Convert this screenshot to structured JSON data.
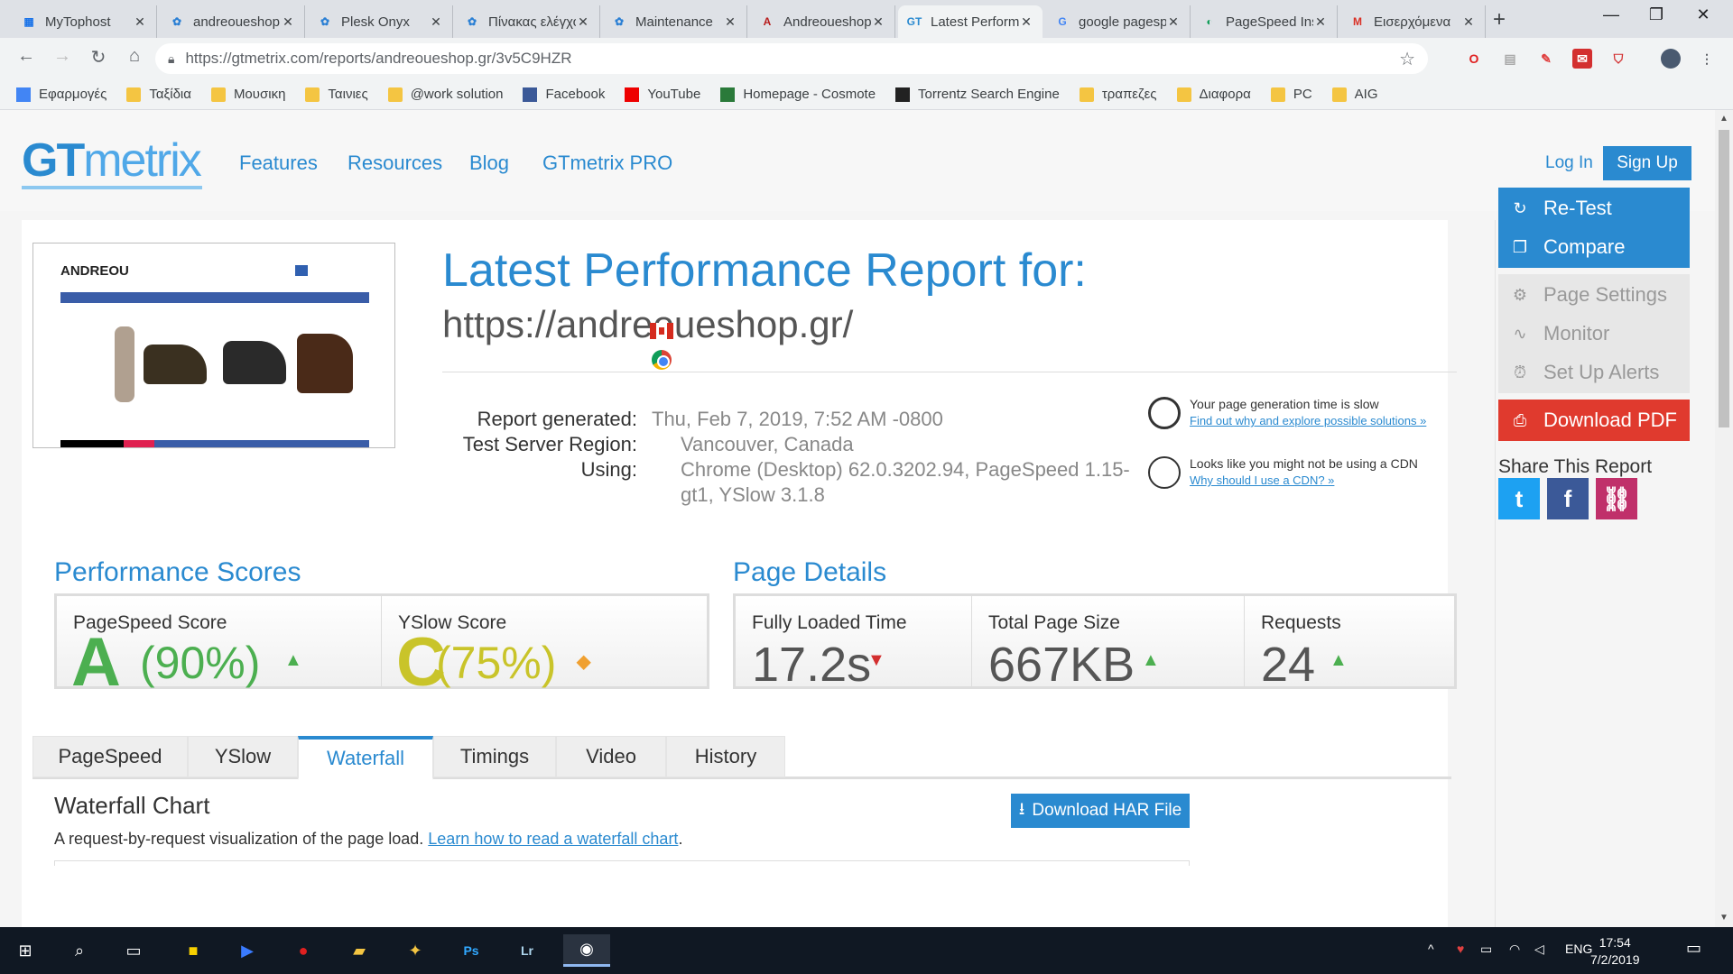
{
  "browser": {
    "tabs": [
      {
        "label": "MyTophost",
        "icon": "grid-icon",
        "color": "#1a73e8"
      },
      {
        "label": "andreoueshop",
        "icon": "plesk-icon",
        "color": "#2a7fd4"
      },
      {
        "label": "Plesk Onyx",
        "icon": "plesk-icon",
        "color": "#2a7fd4"
      },
      {
        "label": "Πίνακας ελέγχου",
        "icon": "plesk-icon",
        "color": "#2a7fd4"
      },
      {
        "label": "Maintenance",
        "icon": "plesk-icon",
        "color": "#2a7fd4"
      },
      {
        "label": "Andreoueshop",
        "icon": "a-logo-icon",
        "color": "#b71c1c"
      },
      {
        "label": "Latest Performance",
        "icon": "gtmetrix-icon",
        "color": "#2a8ad0"
      },
      {
        "label": "google pagespeed",
        "icon": "google-icon",
        "color": "#4285f4"
      },
      {
        "label": "PageSpeed Insights",
        "icon": "pagespeed-icon",
        "color": "#0f9d58"
      },
      {
        "label": "Εισερχόμενα",
        "icon": "gmail-icon",
        "color": "#d93025"
      }
    ],
    "tab_glyphs": [
      "▦",
      "✿",
      "✿",
      "✿",
      "✿",
      "A",
      "GT",
      "G",
      "◐",
      "M"
    ],
    "active_tab": 6,
    "new_tab": "+",
    "url": "https://gtmetrix.com/reports/andreoueshop.gr/3v5C9HZR",
    "bookmarks": [
      {
        "label": "Εφαρμογές",
        "icon": "apps-icon"
      },
      {
        "label": "Ταξίδια",
        "icon": "folder-icon"
      },
      {
        "label": "Μουσικη",
        "icon": "folder-icon"
      },
      {
        "label": "Ταινιες",
        "icon": "folder-icon"
      },
      {
        "label": "@work solution",
        "icon": "folder-icon"
      },
      {
        "label": "Facebook",
        "icon": "facebook-icon"
      },
      {
        "label": "YouTube",
        "icon": "youtube-icon"
      },
      {
        "label": "Homepage - Cosmote",
        "icon": "cosmote-icon"
      },
      {
        "label": "Torrentz Search Engine",
        "icon": "torrentz-icon"
      },
      {
        "label": "τραπεζες",
        "icon": "folder-icon"
      },
      {
        "label": "Διαφορα",
        "icon": "folder-icon"
      },
      {
        "label": "PC",
        "icon": "folder-icon"
      },
      {
        "label": "AIG",
        "icon": "folder-icon"
      }
    ]
  },
  "site": {
    "logo_gt": "GT",
    "logo_metrix": "metrix",
    "nav": [
      "Features",
      "Resources",
      "Blog",
      "GTmetrix PRO"
    ],
    "login": "Log In",
    "signup": "Sign Up"
  },
  "report": {
    "title": "Latest Performance Report for:",
    "url": "https://andreoueshop.gr/",
    "thumb_brand": "ANDREOU",
    "generated_label": "Report generated:",
    "generated_value": "Thu, Feb 7, 2019, 7:52 AM -0800",
    "region_label": "Test Server Region:",
    "region_value": "Vancouver, Canada",
    "using_label": "Using:",
    "using_value_1": "Chrome (Desktop) 62.0.3202.94, PageSpeed 1.15-",
    "using_value_2": "gt1, YSlow 3.1.8",
    "tip1_text": "Your page generation time is slow",
    "tip1_link": "Find out why and explore possible solutions »",
    "tip2_text": "Looks like you might not be using a CDN",
    "tip2_link": "Why should I use a CDN? »"
  },
  "scores": {
    "title": "Performance Scores",
    "pagespeed_label": "PageSpeed Score",
    "pagespeed_grade": "A",
    "pagespeed_pct": "(90%)",
    "pagespeed_color": "#4caf50",
    "yslow_label": "YSlow Score",
    "yslow_grade": "C",
    "yslow_pct": "(75%)",
    "yslow_color": "#c9c42a"
  },
  "details": {
    "title": "Page Details",
    "load_label": "Fully Loaded Time",
    "load_value": "17.2s",
    "size_label": "Total Page Size",
    "size_value": "667KB",
    "req_label": "Requests",
    "req_value": "24"
  },
  "tabs": [
    "PageSpeed",
    "YSlow",
    "Waterfall",
    "Timings",
    "Video",
    "History"
  ],
  "active_tab": "Waterfall",
  "waterfall": {
    "title": "Waterfall Chart",
    "desc": "A request-by-request visualization of the page load.",
    "link": "Learn how to read a waterfall chart",
    "har_button": "Download HAR File"
  },
  "sidebar": {
    "retest": "Re-Test",
    "compare": "Compare",
    "page_settings": "Page Settings",
    "monitor": "Monitor",
    "alerts": "Set Up Alerts",
    "pdf": "Download PDF",
    "share_title": "Share This Report"
  },
  "taskbar": {
    "lang": "ENG",
    "time": "17:54",
    "date": "7/2/2019"
  }
}
